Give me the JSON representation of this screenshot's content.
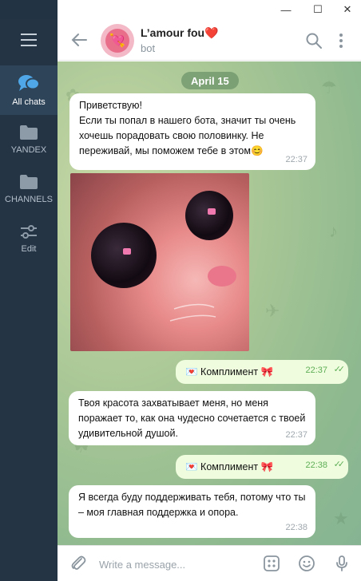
{
  "window": {
    "min_glyph": "—",
    "max_glyph": "☐",
    "close_glyph": "✕"
  },
  "sidebar": {
    "items": [
      {
        "label": "All chats",
        "icon": "chat-bubbles-icon",
        "active": true
      },
      {
        "label": "YANDEX",
        "icon": "folder-icon",
        "active": false
      },
      {
        "label": "CHANNELS",
        "icon": "folder-icon",
        "active": false
      },
      {
        "label": "Edit",
        "icon": "sliders-icon",
        "active": false
      }
    ]
  },
  "header": {
    "title": "L’amour fou❤️",
    "subtitle": "bot",
    "avatar_glyph": "💘"
  },
  "chat": {
    "date": "April 15",
    "messages": [
      {
        "direction": "in",
        "text": "Приветствую!\nЕсли ты попал в нашего бота, значит ты очень хочешь порадовать свою половинку. Не переживай, мы поможем тебе в этом😊",
        "time": "22:37"
      },
      {
        "direction": "in",
        "type": "photo",
        "description_icon": "cat-photo"
      },
      {
        "direction": "out",
        "text": "💌 Комплимент 🎀",
        "time": "22:37",
        "status": "read"
      },
      {
        "direction": "in",
        "text": "Твоя красота захватывает меня, но меня поражает то, как она чудесно сочетается с твоей удивительной душой.",
        "time": "22:37"
      },
      {
        "direction": "out",
        "text": "💌 Комплимент 🎀",
        "time": "22:38",
        "status": "read"
      },
      {
        "direction": "in",
        "text": "Я всегда буду поддерживать тебя, потому что ты – моя главная поддержка и опора.",
        "time": "22:38"
      }
    ]
  },
  "composer": {
    "placeholder": "Write a message..."
  },
  "colors": {
    "rail_bg": "#253445",
    "rail_active": "#2e4459",
    "incoming_bubble": "#ffffff",
    "outgoing_bubble": "#effdde",
    "accent_green": "#5fae57"
  }
}
